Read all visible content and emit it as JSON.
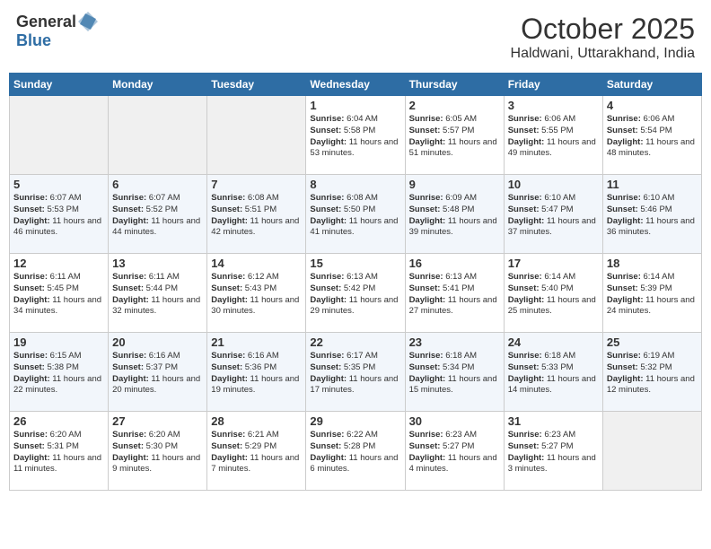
{
  "header": {
    "logo_general": "General",
    "logo_blue": "Blue",
    "month": "October 2025",
    "location": "Haldwani, Uttarakhand, India"
  },
  "days_of_week": [
    "Sunday",
    "Monday",
    "Tuesday",
    "Wednesday",
    "Thursday",
    "Friday",
    "Saturday"
  ],
  "weeks": [
    [
      {
        "day": "",
        "info": ""
      },
      {
        "day": "",
        "info": ""
      },
      {
        "day": "",
        "info": ""
      },
      {
        "day": "1",
        "info": "Sunrise: 6:04 AM\nSunset: 5:58 PM\nDaylight: 11 hours and 53 minutes."
      },
      {
        "day": "2",
        "info": "Sunrise: 6:05 AM\nSunset: 5:57 PM\nDaylight: 11 hours and 51 minutes."
      },
      {
        "day": "3",
        "info": "Sunrise: 6:06 AM\nSunset: 5:55 PM\nDaylight: 11 hours and 49 minutes."
      },
      {
        "day": "4",
        "info": "Sunrise: 6:06 AM\nSunset: 5:54 PM\nDaylight: 11 hours and 48 minutes."
      }
    ],
    [
      {
        "day": "5",
        "info": "Sunrise: 6:07 AM\nSunset: 5:53 PM\nDaylight: 11 hours and 46 minutes."
      },
      {
        "day": "6",
        "info": "Sunrise: 6:07 AM\nSunset: 5:52 PM\nDaylight: 11 hours and 44 minutes."
      },
      {
        "day": "7",
        "info": "Sunrise: 6:08 AM\nSunset: 5:51 PM\nDaylight: 11 hours and 42 minutes."
      },
      {
        "day": "8",
        "info": "Sunrise: 6:08 AM\nSunset: 5:50 PM\nDaylight: 11 hours and 41 minutes."
      },
      {
        "day": "9",
        "info": "Sunrise: 6:09 AM\nSunset: 5:48 PM\nDaylight: 11 hours and 39 minutes."
      },
      {
        "day": "10",
        "info": "Sunrise: 6:10 AM\nSunset: 5:47 PM\nDaylight: 11 hours and 37 minutes."
      },
      {
        "day": "11",
        "info": "Sunrise: 6:10 AM\nSunset: 5:46 PM\nDaylight: 11 hours and 36 minutes."
      }
    ],
    [
      {
        "day": "12",
        "info": "Sunrise: 6:11 AM\nSunset: 5:45 PM\nDaylight: 11 hours and 34 minutes."
      },
      {
        "day": "13",
        "info": "Sunrise: 6:11 AM\nSunset: 5:44 PM\nDaylight: 11 hours and 32 minutes."
      },
      {
        "day": "14",
        "info": "Sunrise: 6:12 AM\nSunset: 5:43 PM\nDaylight: 11 hours and 30 minutes."
      },
      {
        "day": "15",
        "info": "Sunrise: 6:13 AM\nSunset: 5:42 PM\nDaylight: 11 hours and 29 minutes."
      },
      {
        "day": "16",
        "info": "Sunrise: 6:13 AM\nSunset: 5:41 PM\nDaylight: 11 hours and 27 minutes."
      },
      {
        "day": "17",
        "info": "Sunrise: 6:14 AM\nSunset: 5:40 PM\nDaylight: 11 hours and 25 minutes."
      },
      {
        "day": "18",
        "info": "Sunrise: 6:14 AM\nSunset: 5:39 PM\nDaylight: 11 hours and 24 minutes."
      }
    ],
    [
      {
        "day": "19",
        "info": "Sunrise: 6:15 AM\nSunset: 5:38 PM\nDaylight: 11 hours and 22 minutes."
      },
      {
        "day": "20",
        "info": "Sunrise: 6:16 AM\nSunset: 5:37 PM\nDaylight: 11 hours and 20 minutes."
      },
      {
        "day": "21",
        "info": "Sunrise: 6:16 AM\nSunset: 5:36 PM\nDaylight: 11 hours and 19 minutes."
      },
      {
        "day": "22",
        "info": "Sunrise: 6:17 AM\nSunset: 5:35 PM\nDaylight: 11 hours and 17 minutes."
      },
      {
        "day": "23",
        "info": "Sunrise: 6:18 AM\nSunset: 5:34 PM\nDaylight: 11 hours and 15 minutes."
      },
      {
        "day": "24",
        "info": "Sunrise: 6:18 AM\nSunset: 5:33 PM\nDaylight: 11 hours and 14 minutes."
      },
      {
        "day": "25",
        "info": "Sunrise: 6:19 AM\nSunset: 5:32 PM\nDaylight: 11 hours and 12 minutes."
      }
    ],
    [
      {
        "day": "26",
        "info": "Sunrise: 6:20 AM\nSunset: 5:31 PM\nDaylight: 11 hours and 11 minutes."
      },
      {
        "day": "27",
        "info": "Sunrise: 6:20 AM\nSunset: 5:30 PM\nDaylight: 11 hours and 9 minutes."
      },
      {
        "day": "28",
        "info": "Sunrise: 6:21 AM\nSunset: 5:29 PM\nDaylight: 11 hours and 7 minutes."
      },
      {
        "day": "29",
        "info": "Sunrise: 6:22 AM\nSunset: 5:28 PM\nDaylight: 11 hours and 6 minutes."
      },
      {
        "day": "30",
        "info": "Sunrise: 6:23 AM\nSunset: 5:27 PM\nDaylight: 11 hours and 4 minutes."
      },
      {
        "day": "31",
        "info": "Sunrise: 6:23 AM\nSunset: 5:27 PM\nDaylight: 11 hours and 3 minutes."
      },
      {
        "day": "",
        "info": ""
      }
    ]
  ]
}
